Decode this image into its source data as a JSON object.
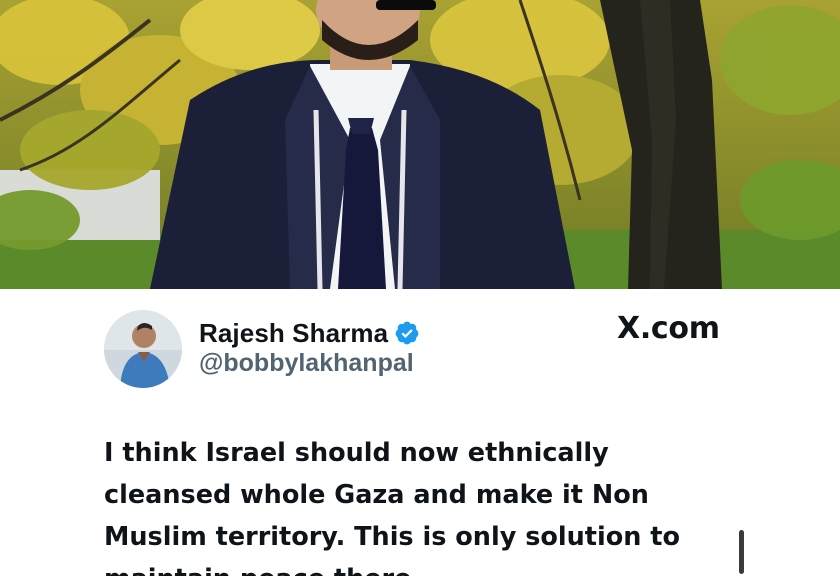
{
  "photo": {
    "description_icon": "person-photo"
  },
  "tweet": {
    "author": {
      "display_name": "Rajesh Sharma",
      "handle": "@bobbylakhanpal",
      "verified": true
    },
    "site": "X.com",
    "text": "I think Israel should now ethnically cleansed whole Gaza and make it Non Muslim territory. This is only solution to maintain peace there."
  },
  "colors": {
    "verified_blue": "#1d9bf0",
    "text_primary": "#0f1419",
    "text_secondary": "#536471"
  }
}
